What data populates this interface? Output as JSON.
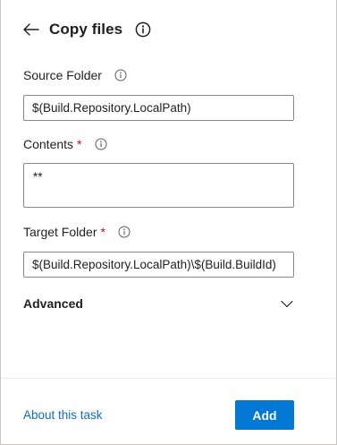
{
  "header": {
    "title": "Copy files",
    "back_icon": "back-arrow-icon",
    "info_icon": "info-icon"
  },
  "fields": {
    "source_folder": {
      "label": "Source Folder",
      "value": "$(Build.Repository.LocalPath)",
      "required": false
    },
    "contents": {
      "label": "Contents",
      "value": "**",
      "required": true,
      "required_mark": "*"
    },
    "target_folder": {
      "label": "Target Folder",
      "value": "$(Build.Repository.LocalPath)\\$(Build.BuildId)",
      "required": true,
      "required_mark": "*"
    }
  },
  "advanced": {
    "label": "Advanced",
    "icon": "chevron-down-icon"
  },
  "footer": {
    "about_link": "About this task",
    "add_button": "Add"
  },
  "colors": {
    "accent": "#0078d4",
    "link": "#0f6cbd",
    "required": "#c50f1f",
    "border": "#8a8886"
  }
}
